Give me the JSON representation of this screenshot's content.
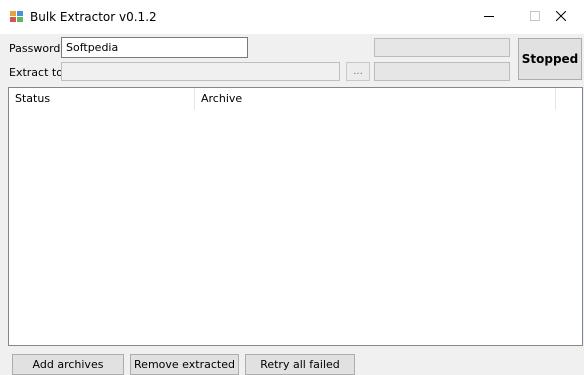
{
  "window": {
    "title": "Bulk Extractor v0.1.2",
    "controls": {
      "minimize_icon": "minimize-icon",
      "maximize_icon": "maximize-icon",
      "close_icon": "close-icon"
    }
  },
  "form": {
    "password_label": "Password:",
    "password_value": "Softpedia",
    "extract_label": "Extract to:",
    "extract_value": "",
    "browse_label": "..."
  },
  "status_button": {
    "label": "Stopped"
  },
  "progress": {
    "top": 0,
    "bottom": 0
  },
  "table": {
    "columns": [
      "Status",
      "Archive"
    ],
    "rows": []
  },
  "buttons": {
    "add": "Add archives",
    "remove": "Remove extracted",
    "retry": "Retry all failed"
  },
  "colors": {
    "accent": "#c0392b",
    "window_bg": "#f0f0f0"
  }
}
